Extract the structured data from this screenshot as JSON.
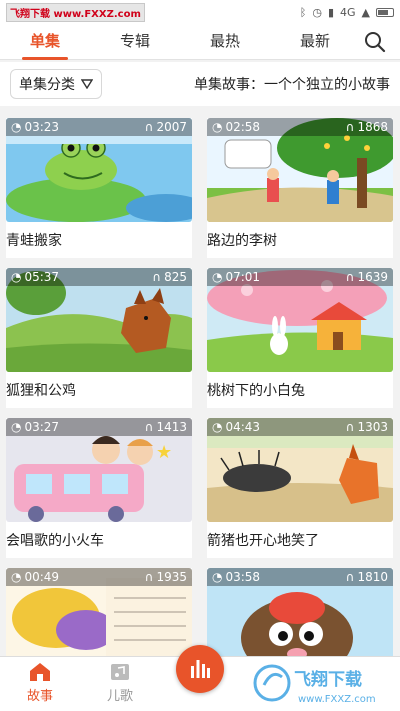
{
  "status_bar": {
    "watermark": "飞翔下载 www.FXXZ.com",
    "network": "4G",
    "colors": {
      "watermark_text": "#d0021b"
    }
  },
  "tabs": [
    {
      "label": "单集",
      "active": true
    },
    {
      "label": "专辑",
      "active": false
    },
    {
      "label": "最热",
      "active": false
    },
    {
      "label": "最新",
      "active": false
    }
  ],
  "filter": {
    "label": "单集分类",
    "description": "单集故事：一个个独立的小故事"
  },
  "episodes": [
    {
      "title": "青蛙搬家",
      "duration": "03:23",
      "plays": "2007",
      "art": "frog"
    },
    {
      "title": "路边的李树",
      "duration": "02:58",
      "plays": "1868",
      "art": "tree"
    },
    {
      "title": "狐狸和公鸡",
      "duration": "05:37",
      "plays": "825",
      "art": "fox"
    },
    {
      "title": "桃树下的小白兔",
      "duration": "07:01",
      "plays": "1639",
      "art": "rabbit"
    },
    {
      "title": "会唱歌的小火车",
      "duration": "03:27",
      "plays": "1413",
      "art": "train"
    },
    {
      "title": "箭猪也开心地笑了",
      "duration": "04:43",
      "plays": "1303",
      "art": "porcupine"
    },
    {
      "title": "",
      "duration": "00:49",
      "plays": "1935",
      "art": "book"
    },
    {
      "title": "",
      "duration": "03:58",
      "plays": "1810",
      "art": "mole"
    }
  ],
  "bottom_nav": {
    "story_label": "故事",
    "songs_label": "儿歌",
    "watermark_brand": "飞翔下载",
    "watermark_url": "www.FXXZ.com"
  },
  "colors": {
    "accent": "#e8542a",
    "inactive": "#999999",
    "overlay": "rgba(0,0,0,0.35)"
  },
  "icons": {
    "clock": "clock-icon",
    "headphones": "headphones-icon",
    "search": "search-icon",
    "home": "home-icon",
    "music": "music-icon",
    "equalizer": "equalizer-icon"
  }
}
